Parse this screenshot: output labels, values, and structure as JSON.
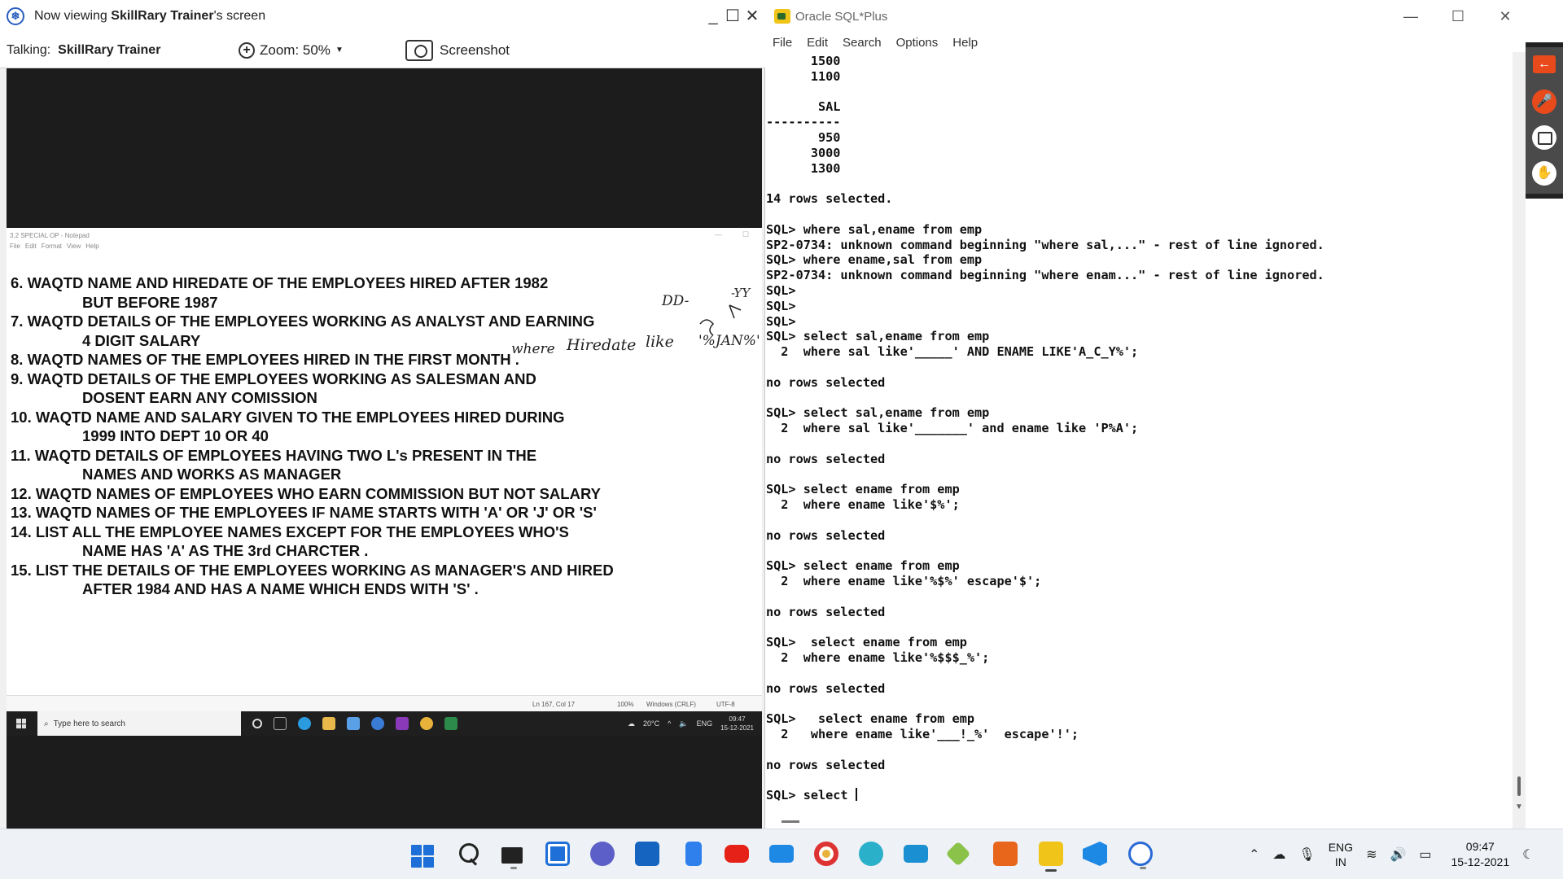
{
  "viewer": {
    "title_prefix": "Now viewing ",
    "title_name": "SkillRary Trainer",
    "title_suffix": "'s screen",
    "talking_label": "Talking:",
    "talking_name": "SkillRary Trainer",
    "zoom_label": "Zoom: 50%",
    "screenshot_label": "Screenshot",
    "controls": [
      "_",
      "☐",
      "✕"
    ]
  },
  "notepad": {
    "title": "3.2 SPECIAL OP - Notepad",
    "menu": [
      "File",
      "Edit",
      "Format",
      "View",
      "Help"
    ],
    "lines": [
      {
        "text": "6. WAQTD NAME AND HIREDATE OF THE EMPLOYEES HIRED AFTER 1982",
        "indent": false
      },
      {
        "text": "BUT BEFORE 1987",
        "indent": true
      },
      {
        "text": "7. WAQTD DETAILS OF THE EMPLOYEES WORKING AS ANALYST AND EARNING",
        "indent": false
      },
      {
        "text": "4 DIGIT SALARY",
        "indent": true
      },
      {
        "text": "8. WAQTD NAMES OF THE EMPLOYEES HIRED IN THE FIRST MONTH .",
        "indent": false
      },
      {
        "text": "9. WAQTD DETAILS OF THE EMPLOYEES WORKING AS SALESMAN AND",
        "indent": false
      },
      {
        "text": "DOSENT EARN ANY COMISSION",
        "indent": true
      },
      {
        "text": "10. WAQTD NAME AND SALARY GIVEN TO THE EMPLOYEES HIRED DURING",
        "indent": false
      },
      {
        "text": "1999 INTO DEPT 10 OR 40",
        "indent": true
      },
      {
        "text": "11. WAQTD DETAILS OF EMPLOYEES HAVING TWO L's PRESENT IN THE",
        "indent": false
      },
      {
        "text": "NAMES AND WORKS AS MANAGER",
        "indent": true
      },
      {
        "text": "12. WAQTD NAMES OF EMPLOYEES WHO EARN COMMISSION BUT NOT SALARY",
        "indent": false
      },
      {
        "text": "13. WAQTD NAMES OF THE EMPLOYEES IF NAME STARTS WITH 'A' OR 'J' OR 'S'",
        "indent": false
      },
      {
        "text": "14. LIST ALL THE EMPLOYEE NAMES EXCEPT FOR THE EMPLOYEES WHO'S",
        "indent": false
      },
      {
        "text": "NAME HAS 'A' AS THE 3rd CHARCTER .",
        "indent": true
      },
      {
        "text": "15. LIST THE DETAILS OF THE EMPLOYEES WORKING AS MANAGER'S AND HIRED",
        "indent": false
      },
      {
        "text": "AFTER 1984 AND HAS A NAME WHICH ENDS WITH 'S' .",
        "indent": true
      }
    ],
    "status": {
      "position": "Ln 167, Col 17",
      "zoom": "100%",
      "line_ending": "Windows (CRLF)",
      "encoding": "UTF-8"
    },
    "annotation_where": "where",
    "annotation_hiredate": "Hiredate",
    "annotation_like": "like",
    "annotation_value": "'%JAN%'",
    "annotation_dd": "DD-",
    "annotation_yy": "-YY"
  },
  "inner_taskbar": {
    "search_placeholder": "Type here to search",
    "temperature": "20°C",
    "lang": "ENG",
    "time": "09:47",
    "date": "15-12-2021"
  },
  "sqlplus": {
    "title": "Oracle SQL*Plus",
    "menu": [
      "File",
      "Edit",
      "Search",
      "Options",
      "Help"
    ],
    "controls": [
      "—",
      "☐",
      "✕"
    ],
    "lines": [
      "      1500",
      "      1100",
      "",
      "       SAL",
      "----------",
      "       950",
      "      3000",
      "      1300",
      "",
      "14 rows selected.",
      "",
      "SQL> where sal,ename from emp",
      "SP2-0734: unknown command beginning \"where sal,...\" - rest of line ignored.",
      "SQL> where ename,sal from emp",
      "SP2-0734: unknown command beginning \"where enam...\" - rest of line ignored.",
      "SQL>",
      "SQL>",
      "SQL>",
      "SQL> select sal,ename from emp",
      "  2  where sal like'_____' AND ENAME LIKE'A_C_Y%';",
      "",
      "no rows selected",
      "",
      "SQL> select sal,ename from emp",
      "  2  where sal like'_______' and ename like 'P%A';",
      "",
      "no rows selected",
      "",
      "SQL> select ename from emp",
      "  2  where ename like'$%';",
      "",
      "no rows selected",
      "",
      "SQL> select ename from emp",
      "  2  where ename like'%$%' escape'$';",
      "",
      "no rows selected",
      "",
      "SQL>  select ename from emp",
      "  2  where ename like'%$$$_%';",
      "",
      "no rows selected",
      "",
      "SQL>   select ename from emp",
      "  2   where ename like'___!_%'  escape'!';",
      "",
      "no rows selected",
      "",
      "SQL> select "
    ]
  },
  "taskbar": {
    "lang_top": "ENG",
    "lang_bottom": "IN",
    "time": "09:47",
    "date": "15-12-2021"
  },
  "colors": {
    "accent_orange": "#e84a1c",
    "windows_blue": "#1f6fd8"
  }
}
